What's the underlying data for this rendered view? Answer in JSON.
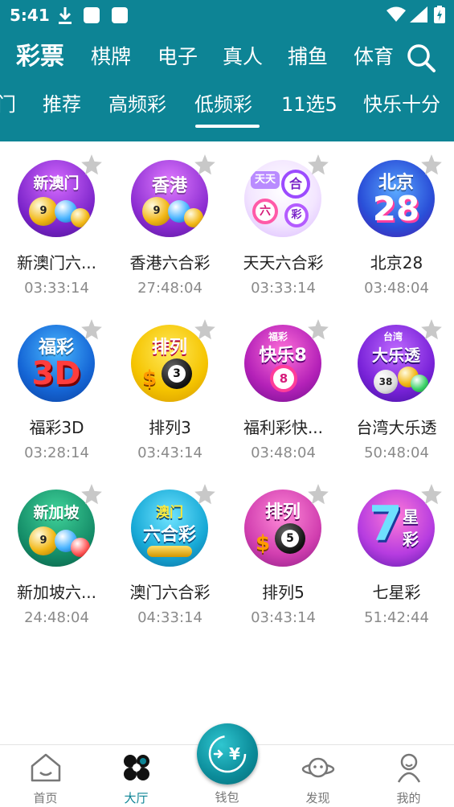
{
  "status_bar": {
    "time": "5:41"
  },
  "categories": [
    {
      "label": "彩票",
      "active": true
    },
    {
      "label": "棋牌",
      "active": false
    },
    {
      "label": "电子",
      "active": false
    },
    {
      "label": "真人",
      "active": false
    },
    {
      "label": "捕鱼",
      "active": false
    },
    {
      "label": "体育",
      "active": false
    }
  ],
  "sub_tabs": [
    {
      "label": "门",
      "active": false
    },
    {
      "label": "推荐",
      "active": false
    },
    {
      "label": "高频彩",
      "active": false
    },
    {
      "label": "低频彩",
      "active": true
    },
    {
      "label": "11选5",
      "active": false
    },
    {
      "label": "快乐十分",
      "active": false
    }
  ],
  "lotteries": [
    {
      "name": "新澳门六...",
      "time": "03:33:14",
      "icon_text": "新澳门",
      "icon": "lottery-balls-icon",
      "ball_number": "9"
    },
    {
      "name": "香港六合彩",
      "time": "27:48:04",
      "icon_text": "香港",
      "icon": "lottery-balls-icon",
      "ball_number": "9"
    },
    {
      "name": "天天六合彩",
      "time": "03:33:14",
      "icon_text": "天天 合 六 彩",
      "icon": "tiantian-icon",
      "ball_number": ""
    },
    {
      "name": "北京28",
      "time": "03:48:04",
      "icon_text": "北京 28",
      "icon": "beijing28-icon",
      "ball_number": ""
    },
    {
      "name": "福彩3D",
      "time": "03:28:14",
      "icon_text": "福彩 3D",
      "icon": "fucai3d-icon",
      "ball_number": ""
    },
    {
      "name": "排列3",
      "time": "03:43:14",
      "icon_text": "排列",
      "icon": "pailie-icon",
      "ball_number": "3"
    },
    {
      "name": "福利彩快...",
      "time": "03:48:04",
      "icon_text": "福彩 快乐8",
      "icon": "kuaile8-icon",
      "ball_number": "8"
    },
    {
      "name": "台湾大乐透",
      "time": "50:48:04",
      "icon_text": "台湾 大乐透",
      "icon": "daletou-icon",
      "ball_number": "38"
    },
    {
      "name": "新加坡六...",
      "time": "24:48:04",
      "icon_text": "新加坡",
      "icon": "lottery-balls-icon",
      "ball_number": "9"
    },
    {
      "name": "澳门六合彩",
      "time": "04:33:14",
      "icon_text": "澳门 六合彩",
      "icon": "macau-icon",
      "ball_number": ""
    },
    {
      "name": "排列5",
      "time": "03:43:14",
      "icon_text": "排列",
      "icon": "pailie-icon",
      "ball_number": "5"
    },
    {
      "name": "七星彩",
      "time": "51:42:44",
      "icon_text": "7 星 彩",
      "icon": "qixingcai-icon",
      "ball_number": ""
    }
  ],
  "bottom_nav": [
    {
      "label": "首页",
      "icon": "home-icon",
      "active": false
    },
    {
      "label": "大厅",
      "icon": "lobby-icon",
      "active": true
    },
    {
      "label": "钱包",
      "icon": "wallet-icon",
      "active": false
    },
    {
      "label": "发现",
      "icon": "discover-icon",
      "active": false
    },
    {
      "label": "我的",
      "icon": "profile-icon",
      "active": false
    }
  ],
  "colors": {
    "header": "#0d8495",
    "star": "#c8c8c8",
    "time_text": "#8a8a8a"
  }
}
